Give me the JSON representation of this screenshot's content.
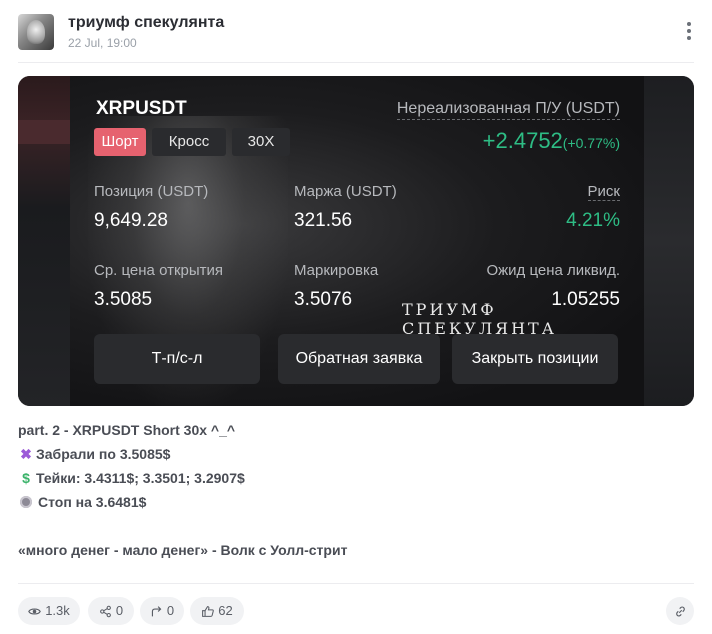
{
  "header": {
    "channel_name": "триумф спекулянта",
    "date": "22 Jul, 19:00"
  },
  "screenshot": {
    "pair": "XRPUSDT",
    "pnl_label": "Нереализованная П/У (USDT)",
    "pnl_value": "+2.4752",
    "pnl_percent": "(+0.77%)",
    "tags": [
      "Шорт",
      "Кросс",
      "30X"
    ],
    "stats": [
      {
        "label": "Позиция (USDT)",
        "value": "9,649.28"
      },
      {
        "label": "Маржа (USDT)",
        "value": "321.56"
      },
      {
        "label": "Риск",
        "value": "4.21%"
      },
      {
        "label": "Ср. цена открытия",
        "value": "3.5085"
      },
      {
        "label": "Маркировка",
        "value": "3.5076"
      },
      {
        "label": "Ожид  цена ликвид.",
        "value": "1.05255"
      }
    ],
    "watermark_line1": "ТРИУМФ",
    "watermark_line2": "СПЕКУЛЯНТА",
    "buttons": [
      "Т-п/с-л",
      "Обратная заявка",
      "Закрыть позиции"
    ],
    "colors": {
      "green": "#2ebd85",
      "short": "#e6626f"
    }
  },
  "post": {
    "line1": "part. 2 - XRPUSDT Short 30x ^_^",
    "line2": "Забрали по 3.5085$",
    "line3": "Тейки: 3.4311$; 3.3501; 3.2907$",
    "line4": "Стоп на 3.6481$",
    "quote": "«много денег - мало денег» - Волк с Уолл-стрит"
  },
  "footer": {
    "views": "1.3k",
    "shares": "0",
    "forwards": "0",
    "reactions": "62"
  }
}
